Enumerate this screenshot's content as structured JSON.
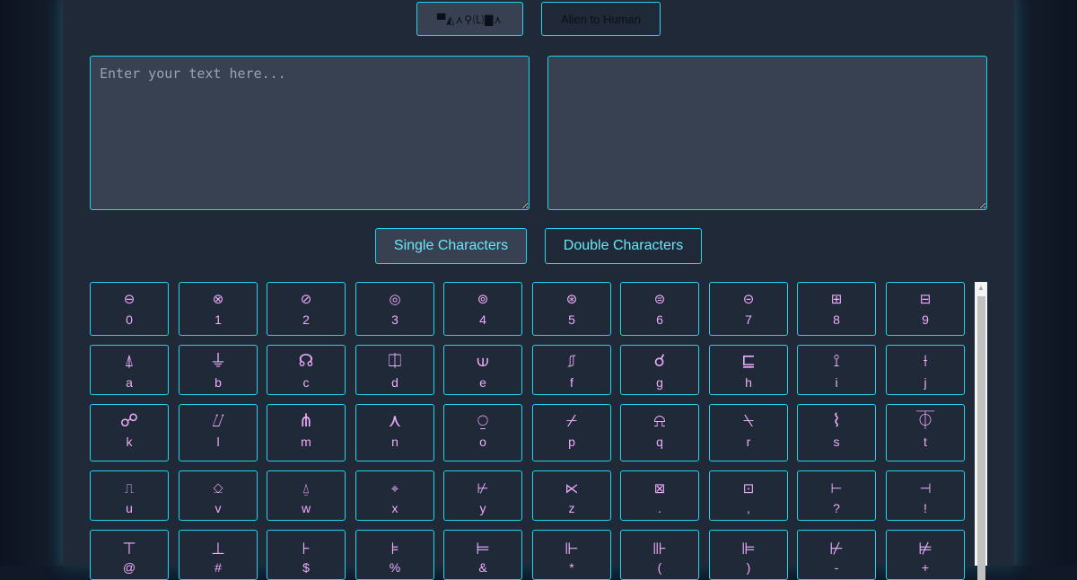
{
  "direction_toggle": {
    "alien_label": "▀◭⋏⚲🄛▇⋏",
    "human_label": "Alien to Human"
  },
  "input": {
    "placeholder": "Enter your text here...",
    "value": ""
  },
  "output": {
    "value": ""
  },
  "mode_tabs": {
    "single_label": "Single Characters",
    "double_label": "Double Characters"
  },
  "keys": [
    {
      "glyph": "⊖",
      "label": "0"
    },
    {
      "glyph": "⊗",
      "label": "1"
    },
    {
      "glyph": "⊘",
      "label": "2"
    },
    {
      "glyph": "◎",
      "label": "3"
    },
    {
      "glyph": "⊚",
      "label": "4"
    },
    {
      "glyph": "⊛",
      "label": "5"
    },
    {
      "glyph": "⊜",
      "label": "6"
    },
    {
      "glyph": "⊝",
      "label": "7"
    },
    {
      "glyph": "⊞",
      "label": "8"
    },
    {
      "glyph": "⊟",
      "label": "9"
    },
    {
      "glyph": "⍋",
      "label": "a"
    },
    {
      "glyph": "⏚",
      "label": "b"
    },
    {
      "glyph": "☊",
      "label": "c"
    },
    {
      "glyph": "⎅",
      "label": "d"
    },
    {
      "glyph": "⟒",
      "label": "e"
    },
    {
      "glyph": "⎎",
      "label": "f"
    },
    {
      "glyph": "☌",
      "label": "g"
    },
    {
      "glyph": "⊑",
      "label": "h"
    },
    {
      "glyph": "⟟",
      "label": "i"
    },
    {
      "glyph": "⟊",
      "label": "j"
    },
    {
      "glyph": "☍",
      "label": "k"
    },
    {
      "glyph": "⌰",
      "label": "l"
    },
    {
      "glyph": "⋔",
      "label": "m"
    },
    {
      "glyph": "⋏",
      "label": "n"
    },
    {
      "glyph": "⍜",
      "label": "o"
    },
    {
      "glyph": "⌿",
      "label": "p"
    },
    {
      "glyph": "⍾",
      "label": "q"
    },
    {
      "glyph": "⍀",
      "label": "r"
    },
    {
      "glyph": "⌇",
      "label": "s"
    },
    {
      "glyph": "⏁",
      "label": "t"
    },
    {
      "glyph": "⎍",
      "label": "u"
    },
    {
      "glyph": "⎐",
      "label": "v"
    },
    {
      "glyph": "⍙",
      "label": "w"
    },
    {
      "glyph": "⌖",
      "label": "x"
    },
    {
      "glyph": "⊬",
      "label": "y"
    },
    {
      "glyph": "⋉",
      "label": "z"
    },
    {
      "glyph": "⊠",
      "label": "."
    },
    {
      "glyph": "⊡",
      "label": ","
    },
    {
      "glyph": "⊢",
      "label": "?"
    },
    {
      "glyph": "⊣",
      "label": "!"
    },
    {
      "glyph": "⊤",
      "label": "@"
    },
    {
      "glyph": "⊥",
      "label": "#"
    },
    {
      "glyph": "⊦",
      "label": "$"
    },
    {
      "glyph": "⊧",
      "label": "%"
    },
    {
      "glyph": "⊨",
      "label": "&"
    },
    {
      "glyph": "⊩",
      "label": "*"
    },
    {
      "glyph": "⊪",
      "label": "("
    },
    {
      "glyph": "⊫",
      "label": ")"
    },
    {
      "glyph": "⊬",
      "label": "-"
    },
    {
      "glyph": "⊭",
      "label": "+"
    }
  ],
  "colors": {
    "accent": "#22d3ee",
    "glyph": "#f0abfc",
    "panel": "#1f2937",
    "input_bg": "#374151"
  }
}
